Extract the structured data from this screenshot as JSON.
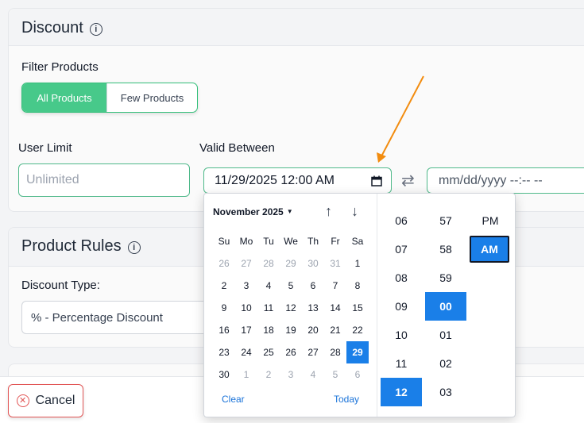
{
  "discount": {
    "title": "Discount",
    "info_glyph": "i",
    "filter_label": "Filter Products",
    "filter_options": [
      "All Products",
      "Few Products"
    ],
    "user_limit_label": "User Limit",
    "user_limit_placeholder": "Unlimited",
    "valid_between_label": "Valid Between",
    "start_value": "11/29/2025 12:00 AM",
    "end_placeholder": "mm/dd/yyyy --:-- --",
    "swap_icon": "⇄"
  },
  "rules": {
    "title": "Product Rules",
    "info_glyph": "i",
    "type_label": "Discount Type:",
    "type_value": "% - Percentage Discount"
  },
  "picker": {
    "month": "November 2025",
    "up_arrow": "↑",
    "down_arrow": "↓",
    "weekdays": [
      "Su",
      "Mo",
      "Tu",
      "We",
      "Th",
      "Fr",
      "Sa"
    ],
    "weeks": [
      [
        "26",
        "27",
        "28",
        "29",
        "30",
        "31",
        "1"
      ],
      [
        "2",
        "3",
        "4",
        "5",
        "6",
        "7",
        "8"
      ],
      [
        "9",
        "10",
        "11",
        "12",
        "13",
        "14",
        "15"
      ],
      [
        "16",
        "17",
        "18",
        "19",
        "20",
        "21",
        "22"
      ],
      [
        "23",
        "24",
        "25",
        "26",
        "27",
        "28",
        "29"
      ],
      [
        "30",
        "1",
        "2",
        "3",
        "4",
        "5",
        "6"
      ]
    ],
    "selected_day": "29",
    "clear_label": "Clear",
    "today_label": "Today",
    "hours": [
      "06",
      "07",
      "08",
      "09",
      "10",
      "11",
      "12"
    ],
    "minutes": [
      "57",
      "58",
      "59",
      "00",
      "01",
      "02",
      "03"
    ],
    "selected_hour": "12",
    "selected_minute": "00",
    "ampm": [
      "PM",
      "AM"
    ],
    "selected_ampm": "AM"
  },
  "footer": {
    "cancel_label": "Cancel",
    "cancel_icon_glyph": "✕"
  },
  "colors": {
    "accent_green": "#47c98a",
    "select_blue": "#1a7fe8",
    "annotation_orange": "#f28c0f",
    "cancel_red": "#e25555"
  },
  "icons": {
    "info": "info-icon",
    "calendar": "calendar-icon",
    "swap": "swap-icon",
    "cancel": "x-circle-icon",
    "annotation": "orange-arrow-annotation"
  }
}
